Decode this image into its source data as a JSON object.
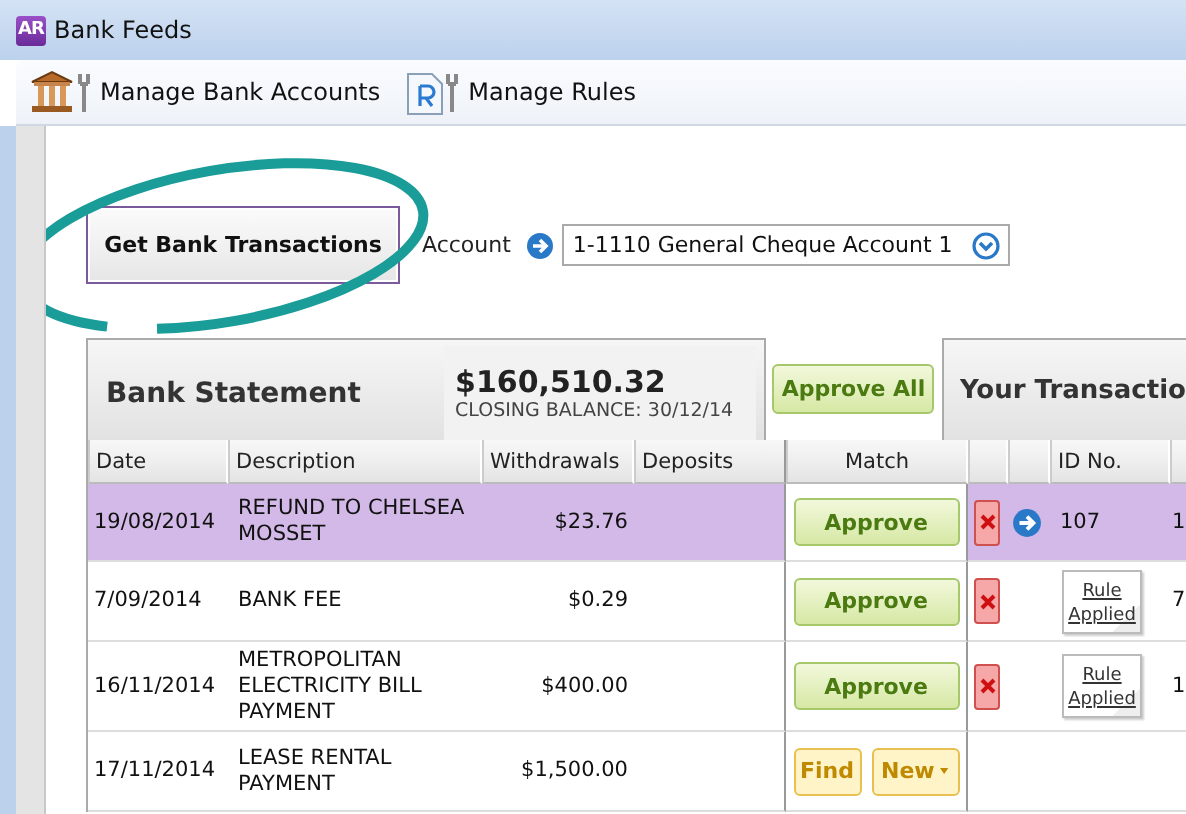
{
  "window": {
    "logo": "AR",
    "title": "Bank Feeds"
  },
  "toolbar": [
    {
      "kind": "bank",
      "label": "Manage Bank Accounts"
    },
    {
      "kind": "rules",
      "label": "Manage Rules"
    }
  ],
  "get_button": "Get Bank Transactions",
  "account": {
    "label": "Account",
    "value": "1-1110 General Cheque Account 1"
  },
  "bank_statement": {
    "title": "Bank Statement",
    "balance": "$160,510.32",
    "balance_caption": "CLOSING BALANCE: 30/12/14"
  },
  "approve_all": "Approve All",
  "your_transactions": {
    "title": "Your Transactio"
  },
  "columns": [
    "Date",
    "Description",
    "Withdrawals",
    "Deposits",
    "Match",
    "ID No."
  ],
  "rows": [
    {
      "date": "19/08/2014",
      "description": "REFUND TO CHELSEA MOSSET",
      "withdrawals": "$23.76",
      "selected": true,
      "match": {
        "kind": "approve",
        "label": "Approve"
      },
      "reject": true,
      "linked": true,
      "id_no": "107",
      "column_9": "1"
    },
    {
      "date": "7/09/2014",
      "description": "BANK FEE",
      "withdrawals": "$0.29",
      "selected": false,
      "match": {
        "kind": "approve",
        "label": "Approve"
      },
      "reject": true,
      "linked": false,
      "rule": "Rule Applied",
      "column_9": "7"
    },
    {
      "date": "16/11/2014",
      "description": "METROPOLITAN ELECTRICITY BILL PAYMENT",
      "withdrawals": "$400.00",
      "selected": false,
      "match": {
        "kind": "approve",
        "label": "Approve"
      },
      "reject": true,
      "linked": false,
      "rule": "Rule Applied",
      "column_9": "1"
    },
    {
      "date": "17/11/2014",
      "description": "LEASE RENTAL PAYMENT",
      "withdrawals": "$1,500.00",
      "selected": false,
      "match": {
        "kind": "find_new",
        "find": "Find",
        "new": "New"
      },
      "reject": false,
      "linked": false
    }
  ]
}
